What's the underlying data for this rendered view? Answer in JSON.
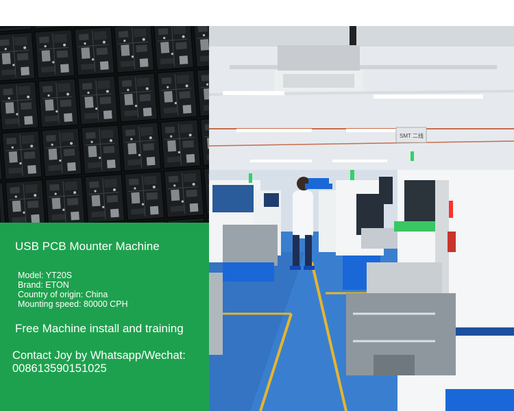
{
  "images": {
    "pcb_photo": "printed circuit boards",
    "factory_photo": "SMT production line with operator"
  },
  "panel": {
    "title": "USB PCB Mounter Machine",
    "specs": [
      "Model: YT20S",
      "Brand: ETON",
      "Country of origin: China",
      "Mounting speed: 80000 CPH"
    ],
    "free_offer": "Free Machine install and training",
    "contact": "Contact Joy by Whatsapp/Wechat:",
    "phone": "008613590151025"
  },
  "factory": {
    "sign_text": "SMT 二线"
  },
  "colors": {
    "panel_green": "#1ea14e",
    "machine_white": "#f2f4f5",
    "floor_blue": "#3a7fcf",
    "stripe_yellow": "#e4b530"
  }
}
